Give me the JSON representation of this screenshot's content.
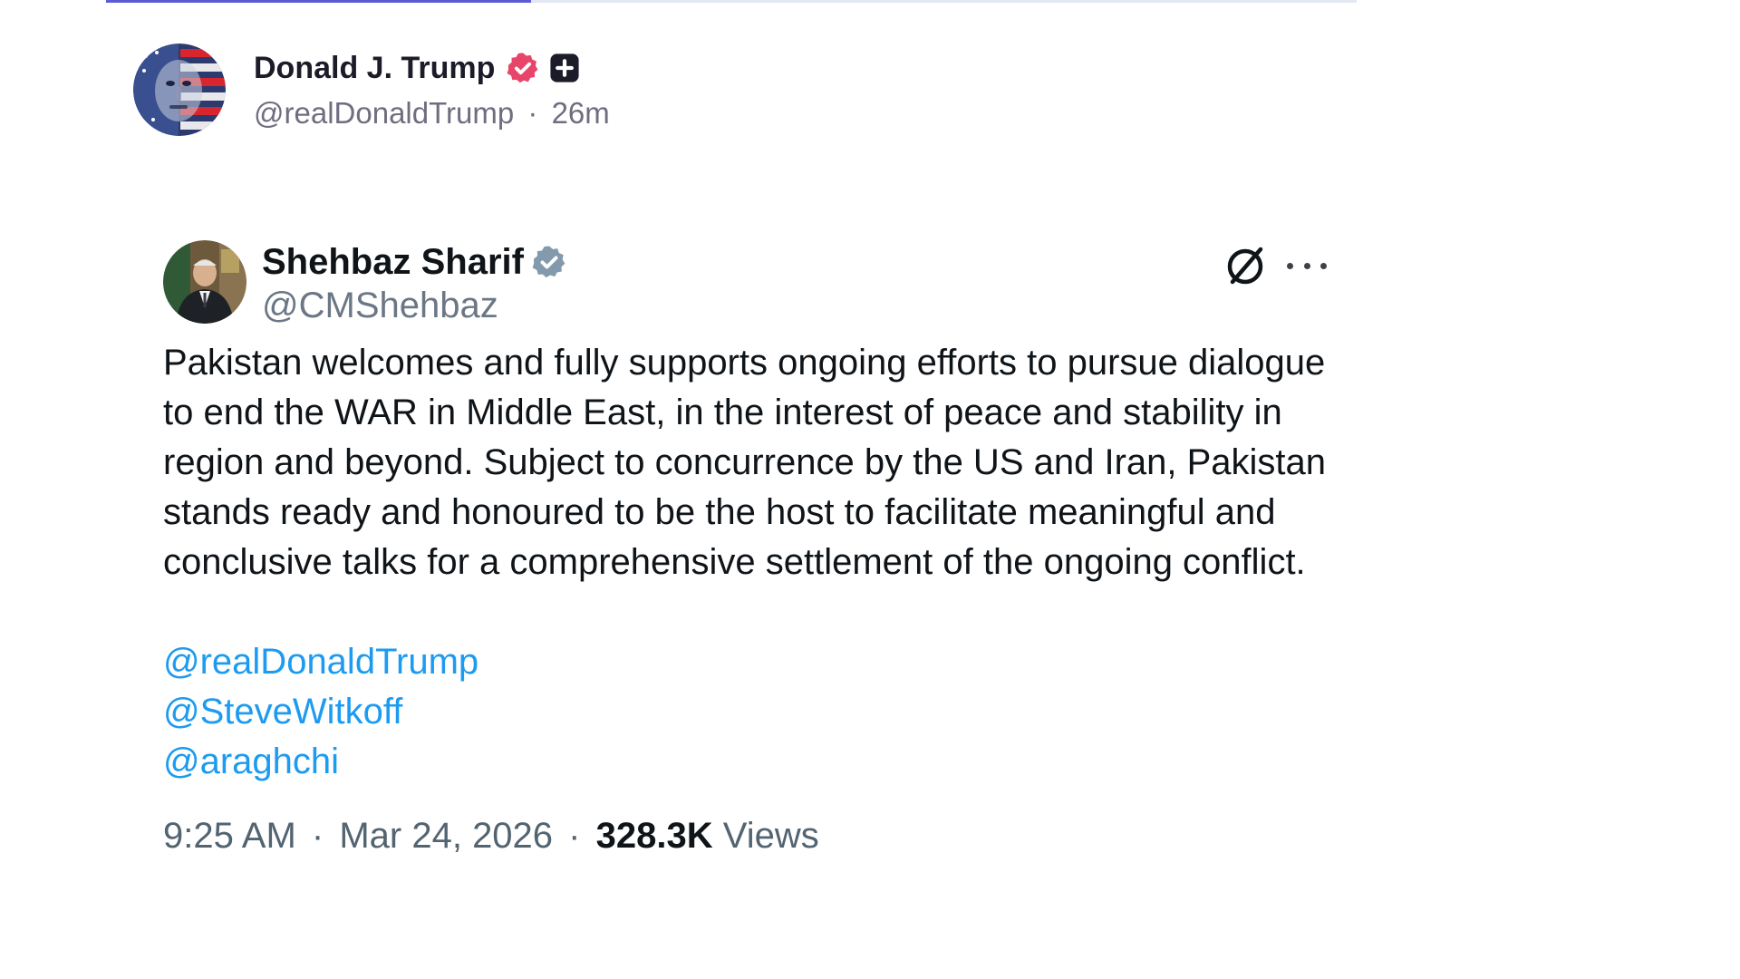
{
  "post": {
    "author_name": "Donald J. Trump",
    "author_handle": "@realDonaldTrump",
    "separator": "·",
    "time_ago": "26m",
    "badge_icon": "verified-pink-icon",
    "plus_icon": "plus-square-icon"
  },
  "tweet": {
    "author_name": "Shehbaz Sharif",
    "author_handle": "@CMShehbaz",
    "badge_icon": "verified-gray-icon",
    "body": "Pakistan welcomes and fully supports ongoing efforts to pursue dialogue to end the WAR in Middle East, in the interest of peace and stability in region and beyond. Subject to concurrence by the US and Iran, Pakistan stands ready and honoured to be the host to facilitate meaningful and conclusive talks for a comprehensive settlement of the ongoing conflict.",
    "mentions": [
      "@realDonaldTrump",
      "@SteveWitkoff",
      "@araghchi"
    ],
    "time": "9:25 AM",
    "separator": "·",
    "date": "Mar 24, 2026",
    "views_count": "328.3K",
    "views_label": "Views"
  },
  "colors": {
    "link": "#1d9bf0",
    "verified_pink": "#e8456b",
    "verified_gray": "#829aab",
    "top_bar_accent": "#5b5bd6"
  },
  "top_bar": {
    "progress": 0.34
  }
}
